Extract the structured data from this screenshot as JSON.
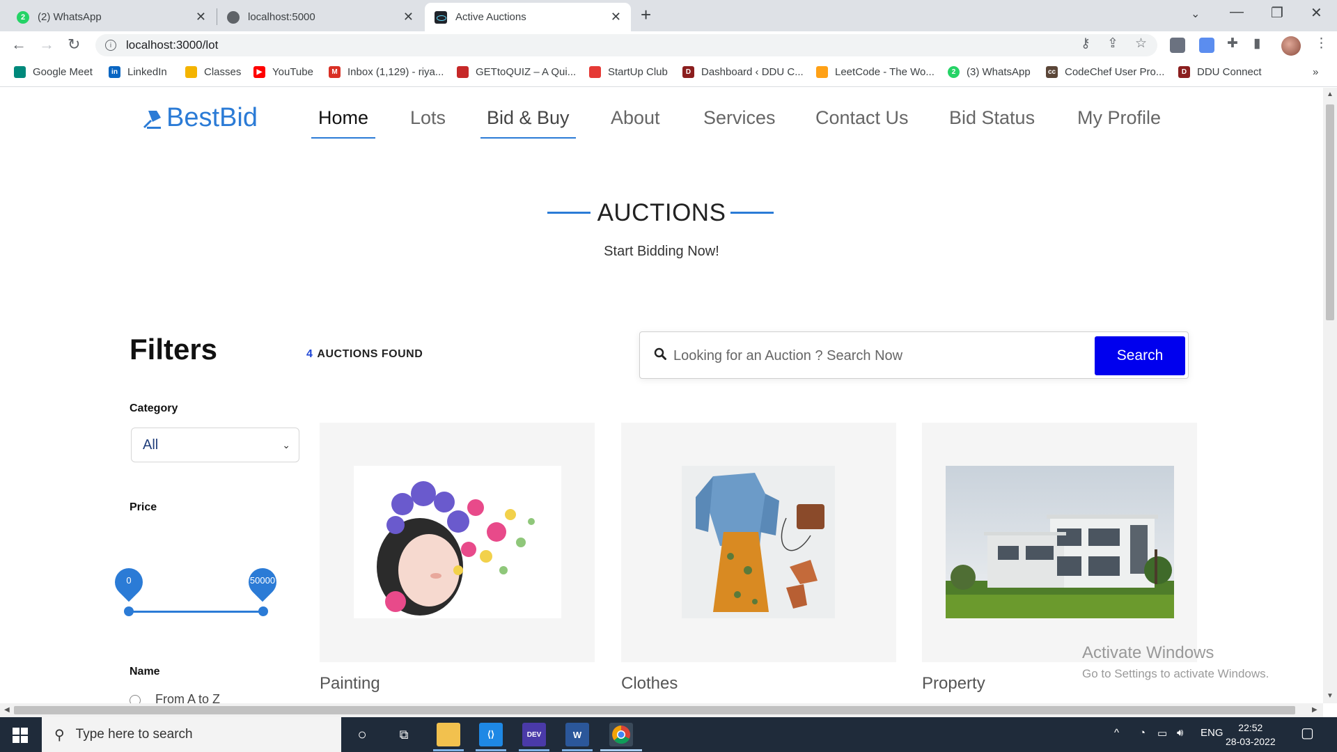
{
  "browser": {
    "tabs": [
      {
        "title": "(2) WhatsApp",
        "icon": "whatsapp-icon"
      },
      {
        "title": "localhost:5000",
        "icon": "globe-icon"
      },
      {
        "title": "Active Auctions",
        "icon": "react-icon"
      }
    ],
    "url": "localhost:3000/lot",
    "bookmarks": [
      {
        "label": "Google Meet",
        "color": "#00897b"
      },
      {
        "label": "LinkedIn",
        "color": "#0a66c2"
      },
      {
        "label": "Classes",
        "color": "#f4b400"
      },
      {
        "label": "YouTube",
        "color": "#ff0000"
      },
      {
        "label": "Inbox (1,129) - riya...",
        "color": "#d93025"
      },
      {
        "label": "GETtoQUIZ – A Qui...",
        "color": "#c62828"
      },
      {
        "label": "StartUp Club",
        "color": "#e53935"
      },
      {
        "label": "Dashboard ‹ DDU C...",
        "color": "#8b1e1e"
      },
      {
        "label": "LeetCode - The Wo...",
        "color": "#ffa116"
      },
      {
        "label": "(3) WhatsApp",
        "color": "#25d366"
      },
      {
        "label": "CodeChef User Pro...",
        "color": "#5b4638"
      },
      {
        "label": "DDU Connect",
        "color": "#8b1e1e"
      }
    ]
  },
  "site": {
    "logo": "BestBid",
    "nav": [
      "Home",
      "Lots",
      "Bid & Buy",
      "About",
      "Services",
      "Contact Us",
      "Bid Status",
      "My Profile"
    ]
  },
  "hero": {
    "title": "AUCTIONS",
    "subtitle": "Start Bidding Now!"
  },
  "filters": {
    "title": "Filters",
    "category_label": "Category",
    "category_value": "All",
    "price_label": "Price",
    "price_min": "0",
    "price_max": "50000",
    "name_label": "Name",
    "name_option": "From A to Z"
  },
  "results": {
    "count": "4",
    "label": "AUCTIONS FOUND"
  },
  "search": {
    "placeholder": "Looking for an Auction ? Search Now",
    "button": "Search"
  },
  "cards": [
    {
      "title": "Painting",
      "image": "watercolor-flower-girl"
    },
    {
      "title": "Clothes",
      "image": "denim-jacket-outfit"
    },
    {
      "title": "Property",
      "image": "modern-villa"
    }
  ],
  "watermark": {
    "line1": "Activate Windows",
    "line2": "Go to Settings to activate Windows."
  },
  "taskbar": {
    "search_placeholder": "Type here to search",
    "lang": "ENG",
    "time": "22:52",
    "date": "28-03-2022"
  }
}
